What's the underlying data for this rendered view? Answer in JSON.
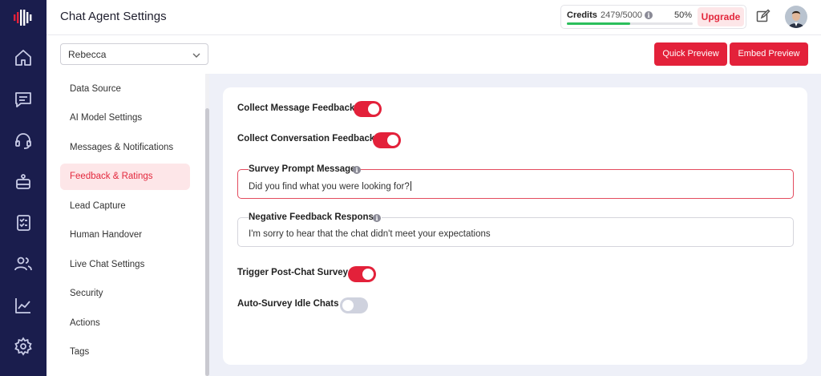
{
  "header": {
    "title": "Chat Agent Settings",
    "credits": {
      "label": "Credits",
      "value": "2479/5000",
      "percent_text": "50%",
      "progress": 0.5,
      "upgrade_label": "Upgrade"
    }
  },
  "rail": {
    "icons": [
      "logo-icon",
      "home-icon",
      "chat-icon",
      "headset-icon",
      "bot-icon",
      "checklist-icon",
      "users-icon",
      "analytics-icon",
      "settings-gear-icon"
    ]
  },
  "toolbar": {
    "agent_select_value": "Rebecca",
    "quick_preview_label": "Quick Preview",
    "embed_preview_label": "Embed Preview"
  },
  "settings_nav": {
    "items": [
      {
        "label": "Data Source",
        "active": false
      },
      {
        "label": "AI Model Settings",
        "active": false
      },
      {
        "label": "Messages & Notifications",
        "active": false
      },
      {
        "label": "Feedback & Ratings",
        "active": true
      },
      {
        "label": "Lead Capture",
        "active": false
      },
      {
        "label": "Human Handover",
        "active": false
      },
      {
        "label": "Live Chat Settings",
        "active": false
      },
      {
        "label": "Security",
        "active": false
      },
      {
        "label": "Actions",
        "active": false
      },
      {
        "label": "Tags",
        "active": false
      }
    ]
  },
  "feedback": {
    "collect_message_feedback": {
      "label": "Collect Message Feedback",
      "on": true
    },
    "collect_conversation_feedback": {
      "label": "Collect Conversation Feedback",
      "on": true
    },
    "survey_prompt": {
      "label": "Survey Prompt Message",
      "value": "Did you find what you were looking for?"
    },
    "negative_response": {
      "label": "Negative Feedback Response",
      "value": "I'm sorry to hear that the chat didn't meet your expectations"
    },
    "trigger_post_chat_survey": {
      "label": "Trigger Post-Chat Survey",
      "on": true
    },
    "auto_survey_idle": {
      "label": "Auto-Survey Idle Chats",
      "on": false
    }
  },
  "colors": {
    "rail_bg": "#1a1d4d",
    "accent": "#e3213a",
    "progress": "#2bbf5c",
    "main_bg": "#eef0f8"
  }
}
